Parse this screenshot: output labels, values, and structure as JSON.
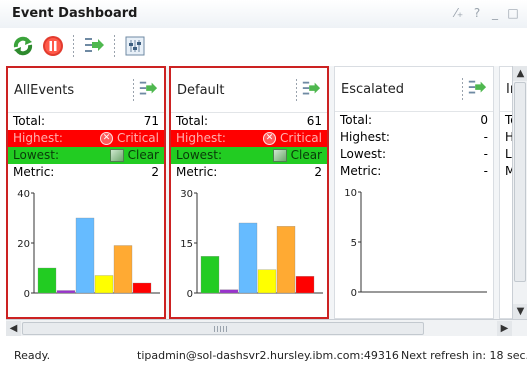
{
  "window": {
    "title": "Event Dashboard",
    "icons": [
      "edit-icon",
      "help-icon",
      "minimize-icon",
      "maximize-icon"
    ],
    "icon_glyphs": [
      "⁄₊",
      "?",
      "_",
      "□"
    ]
  },
  "toolbar": {
    "buttons": [
      "refresh-icon",
      "stop-icon",
      "drill-down-icon",
      "filter-settings-icon"
    ]
  },
  "colors": {
    "alert_border": "#cc2222",
    "highest_row": "#ff0000",
    "lowest_row": "#22cc22",
    "bar_colors": [
      "#22cc22",
      "#9933cc",
      "#66bbff",
      "#ffff00",
      "#ffaa33",
      "#ff0000"
    ]
  },
  "panels": [
    {
      "title": "AllEvents",
      "alert": true,
      "total_label": "Total:",
      "total": "71",
      "highest_label": "Highest:",
      "highest": "Critical",
      "lowest_label": "Lowest:",
      "lowest": "Clear",
      "metric_label": "Metric:",
      "metric": "2"
    },
    {
      "title": "Default",
      "alert": true,
      "total_label": "Total:",
      "total": "61",
      "highest_label": "Highest:",
      "highest": "Critical",
      "lowest_label": "Lowest:",
      "lowest": "Clear",
      "metric_label": "Metric:",
      "metric": "2"
    },
    {
      "title": "Escalated",
      "alert": false,
      "total_label": "Total:",
      "total": "0",
      "highest_label": "Highest:",
      "highest": "-",
      "lowest_label": "Lowest:",
      "lowest": "-",
      "metric_label": "Metric:",
      "metric": "-"
    },
    {
      "title": "In",
      "alert": false,
      "total_label": "To",
      "total": "",
      "highest_label": "H",
      "highest": "",
      "lowest_label": "Lo",
      "lowest": "",
      "metric_label": "M",
      "metric": ""
    }
  ],
  "chart_data": [
    {
      "type": "bar",
      "panel": "AllEvents",
      "categories": [
        "1",
        "2",
        "3",
        "4",
        "5",
        "6"
      ],
      "values": [
        10,
        1,
        30,
        7,
        19,
        4
      ],
      "ylim": [
        0,
        40
      ],
      "yticks": [
        "0",
        "20",
        "40"
      ]
    },
    {
      "type": "bar",
      "panel": "Default",
      "categories": [
        "1",
        "2",
        "3",
        "4",
        "5",
        "6"
      ],
      "values": [
        11,
        1,
        21,
        7,
        20,
        5
      ],
      "ylim": [
        0,
        30
      ],
      "yticks": [
        "0",
        "15",
        "30"
      ]
    },
    {
      "type": "bar",
      "panel": "Escalated",
      "categories": [],
      "values": [],
      "ylim": [
        0,
        10
      ],
      "yticks": [
        "0",
        "5",
        "10"
      ]
    },
    {
      "type": "bar",
      "panel": "In",
      "categories": [],
      "values": [],
      "ylim": [
        0,
        10
      ],
      "yticks": [
        "1"
      ]
    }
  ],
  "status": {
    "ready": "Ready.",
    "user": "tipadmin@sol-dashsvr2.hursley.ibm.com:49316",
    "refresh": "Next refresh in: 18 sec."
  }
}
